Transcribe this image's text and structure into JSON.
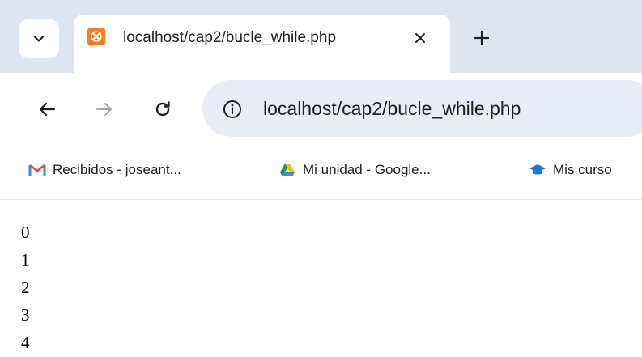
{
  "tab": {
    "title": "localhost/cap2/bucle_while.php",
    "favicon": "xampp-icon"
  },
  "toolbar": {
    "url": "localhost/cap2/bucle_while.php"
  },
  "bookmarks": [
    {
      "label": "Recibidos - joseant...",
      "icon": "gmail-icon"
    },
    {
      "label": "Mi unidad - Google...",
      "icon": "google-drive-icon"
    },
    {
      "label": "Mis curso",
      "icon": "graduation-cap-icon"
    }
  ],
  "page": {
    "lines": [
      "0",
      "1",
      "2",
      "3",
      "4"
    ]
  },
  "colors": {
    "tabstrip": "#dfe5ef",
    "omnibox": "#e9eef6",
    "favicon": "#fb7a24"
  }
}
